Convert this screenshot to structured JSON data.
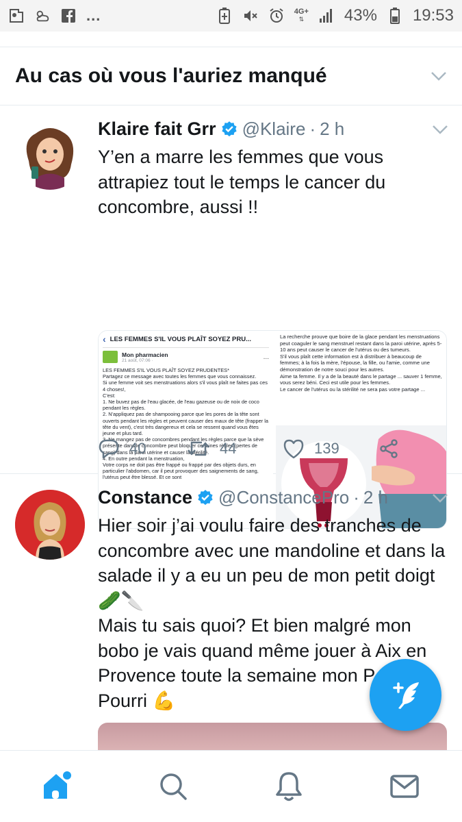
{
  "status_bar": {
    "network": "4G+",
    "battery": "43%",
    "time": "19:53",
    "more": "...",
    "icons_left": [
      "location-icon",
      "weather-icon",
      "facebook-icon"
    ],
    "icons_right": [
      "battery-saver-icon",
      "mute-icon",
      "alarm-icon",
      "signal-icon",
      "battery-icon"
    ]
  },
  "section": {
    "title": "Au cas où vous l'auriez manqué"
  },
  "tweets": [
    {
      "name": "Klaire fait Grr",
      "handle": "@Klaire",
      "time": "2 h",
      "text": "Y’en a marre les femmes que vous attrapiez tout le temps le cancer du concombre, aussi !!",
      "media_left": {
        "header": "LES FEMMES S'IL VOUS PLAÎT SOYEZ PRU...",
        "author": "Mon pharmacien",
        "date": "21 août, 07:06 ·",
        "more": "...",
        "body": "LES FEMMES S'IL VOUS PLAÎT SOYEZ PRUDENTES*\nPartagez ce message avec toutes les femmes que vous connaissez.\nSi une femme voit ses menstruations alors s'il vous plaît ne faites pas ces 4 choses!,\nC'est:\n1. Ne buvez pas de l'eau glacée, de l'eau gazeuse ou de noix de coco pendant les règles.\n2. N'appliquez pas de shampooing parce que les pores de la tête sont ouverts pendant les règles et peuvent causer des maux de tête (frapper la tête du vent), c'est très dangereux et cela se ressent quand vous êtes jeune et plus tard.\n3. Ne mangez pas de concombres pendant les règles parce que la sève présente dans le concombre peut bloquer certaines règles (pertes de sang) dans la paroi utérine et causer la stérilité.\n4. En outre pendant la menstruation,\nVotre corps ne doit pas être frappé ou frappé par des objets durs, en particulier l'abdomen, car il peut provoquer des saignements de sang, l'utérus peut être blessé. Et ce sont"
      },
      "media_right": {
        "body": "La recherche prouve que boire de la glace pendant les menstruations peut coaguler le sang menstruel restant dans la paroi utérine, après 5-10 ans peut causer le cancer de l'utérus ou des tumeurs.\nS'il vous plaît cette information est à distribuer à beaucoup de femmes; à la fois la mère, l'épouse, la fille, ou l'amie, comme une démonstration de notre souci pour les autres.\nAime ta femme. Il y a de la beauté dans le partage ... sauver 1 femme, vous serez béni. Ceci est utile pour les femmes.\nLe cancer de l'utérus ou la stérilité ne sera pas votre partage ..."
      },
      "replies": "40",
      "retweets": "44",
      "likes": "139"
    },
    {
      "name": "Constance",
      "handle": "@ConstancePro",
      "time": "2 h",
      "text": "Hier soir j’ai voulu faire des tranches de concombre avec une mandoline et dans la salade il y a eu un peu de mon petit doigt 🥒🔪\nMais tu sais quoi? Et bien malgré mon bobo je vais quand même jouer à Aix en Provence toute la semaine mon Petit Pourri 💪"
    }
  ],
  "bottom_nav": [
    "home-icon",
    "search-icon",
    "notifications-icon",
    "messages-icon"
  ],
  "colors": {
    "accent": "#1da1f2",
    "text": "#14171a",
    "secondary": "#657786"
  }
}
